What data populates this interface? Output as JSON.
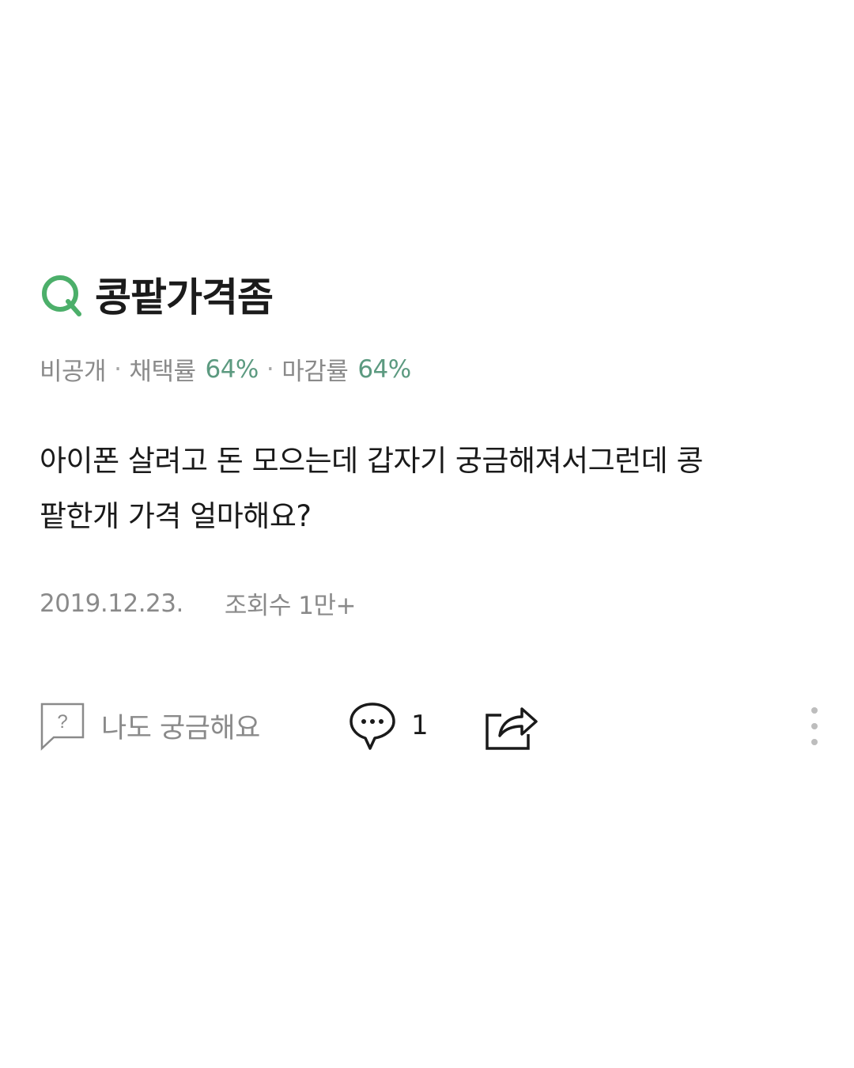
{
  "question": {
    "icon": "q-letter-icon",
    "icon_color": "#4caf6a",
    "title": "콩팥가격좀"
  },
  "meta": {
    "visibility": "비공개",
    "separator": "·",
    "adoption_label": "채택률",
    "adoption_value": "64%",
    "close_label": "마감률",
    "close_value": "64%",
    "accent_color": "#5c9a80"
  },
  "body": {
    "line1": "아이폰 살려고 돈 모으는데 갑자기 궁금해져서그런데 콩",
    "line2": "팥한개 가격 얼마해요?"
  },
  "info": {
    "date": "2019.12.23.",
    "views": "조회수 1만+"
  },
  "actions": {
    "curious_icon": "question-bubble-icon",
    "curious_label": "나도 궁금해요",
    "comment_icon": "comment-bubble-icon",
    "comment_count": "1",
    "share_icon": "share-icon",
    "more_icon": "more-vertical-icon"
  }
}
